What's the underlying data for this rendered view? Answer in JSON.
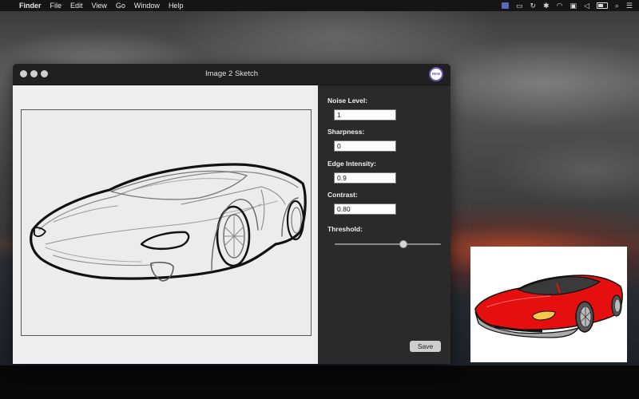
{
  "menubar": {
    "apple_icon": "apple-icon",
    "items": [
      "Finder",
      "File",
      "Edit",
      "View",
      "Go",
      "Window",
      "Help"
    ]
  },
  "window": {
    "title": "Image 2 Sketch",
    "badge_text": "REW"
  },
  "controls": {
    "noise_level": {
      "label": "Noise Level:",
      "value": "1"
    },
    "sharpness": {
      "label": "Sharpness:",
      "value": "0"
    },
    "edge_intensity": {
      "label": "Edge Intensity:",
      "value": "0.9"
    },
    "contrast": {
      "label": "Contrast:",
      "value": "0.80"
    },
    "threshold": {
      "label": "Threshold:",
      "level": 0.65
    },
    "save_label": "Save"
  },
  "colors": {
    "car_body": "#e60f0f",
    "badge_ring": "#6d58b8"
  }
}
